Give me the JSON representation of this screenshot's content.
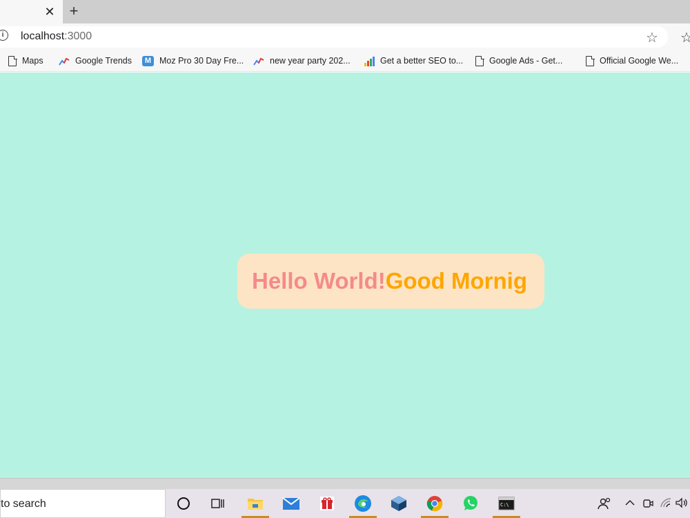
{
  "browser": {
    "tab_close": "✕",
    "new_tab": "+",
    "url_host": "localhost",
    "url_port": ":3000"
  },
  "bookmarks": [
    {
      "label": "Maps",
      "icon": "doc-icon"
    },
    {
      "label": "Google Trends",
      "icon": "trends-icon"
    },
    {
      "label": "Moz Pro 30 Day Fre...",
      "icon": "moz-icon"
    },
    {
      "label": "new year party 202...",
      "icon": "trends-icon"
    },
    {
      "label": "Get a better SEO to...",
      "icon": "bars-chart-icon"
    },
    {
      "label": "Google Ads - Get...",
      "icon": "doc-icon"
    },
    {
      "label": "Official Google We...",
      "icon": "doc-icon"
    }
  ],
  "page": {
    "hello_text": "Hello World!",
    "morning_text": "Good Mornig",
    "colors": {
      "background": "#b6f2e1",
      "card": "#fde4c4",
      "hello": "#f48a8c",
      "morning": "#ffa500"
    }
  },
  "taskbar": {
    "search_text": "to search",
    "icons": [
      "cortana-icon",
      "task-view-icon",
      "file-explorer-icon",
      "mail-icon",
      "gift-icon",
      "edge-icon",
      "virtualbox-icon",
      "chrome-icon",
      "whatsapp-icon",
      "terminal-icon"
    ],
    "tray_icons": [
      "people-icon",
      "chevron-up-icon",
      "meet-now-icon",
      "wifi-icon",
      "volume-icon"
    ]
  }
}
